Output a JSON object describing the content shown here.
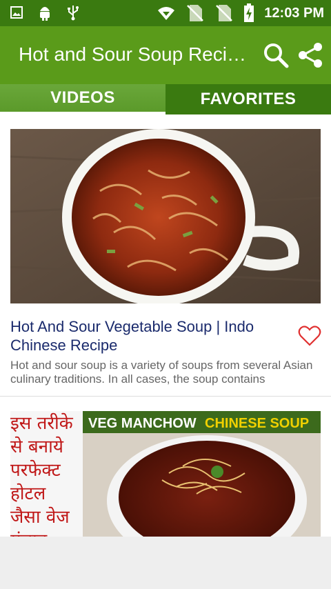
{
  "statusbar": {
    "time": "12:03 PM",
    "icons": [
      "image-icon",
      "android-icon",
      "usb-icon",
      "wifi-icon",
      "no-sim-icon",
      "no-sim-icon",
      "battery-charging-icon"
    ]
  },
  "appbar": {
    "title": "Hot and Sour Soup Recipes",
    "search_icon": "search-icon",
    "share_icon": "share-icon"
  },
  "tabs": [
    {
      "label": "VIDEOS"
    },
    {
      "label": "FAVORITES"
    }
  ],
  "videos": [
    {
      "title": "Hot And Sour Vegetable Soup | Indo Chinese Recipe",
      "description": "Hot and sour soup is a variety of soups from several Asian culinary traditions. In all cases, the soup contains ingredients to make it both spicy and sour."
    },
    {
      "thumbnail_text": {
        "hindi_lines": [
          "इस तरीके",
          "से बनाये",
          "परफेक्ट",
          "होटल",
          "जैसा वेज",
          "मंचाव"
        ],
        "banner_left": "VEG MANCHOW",
        "banner_right": "CHINESE SOUP"
      }
    }
  ],
  "colors": {
    "statusbar": "#3a7a10",
    "appbar": "#5a9b1a",
    "tab_active": "#6aa73a",
    "tab_inactive": "#3a7a10",
    "title_text": "#1a2a6c",
    "heart": "#e03030"
  }
}
